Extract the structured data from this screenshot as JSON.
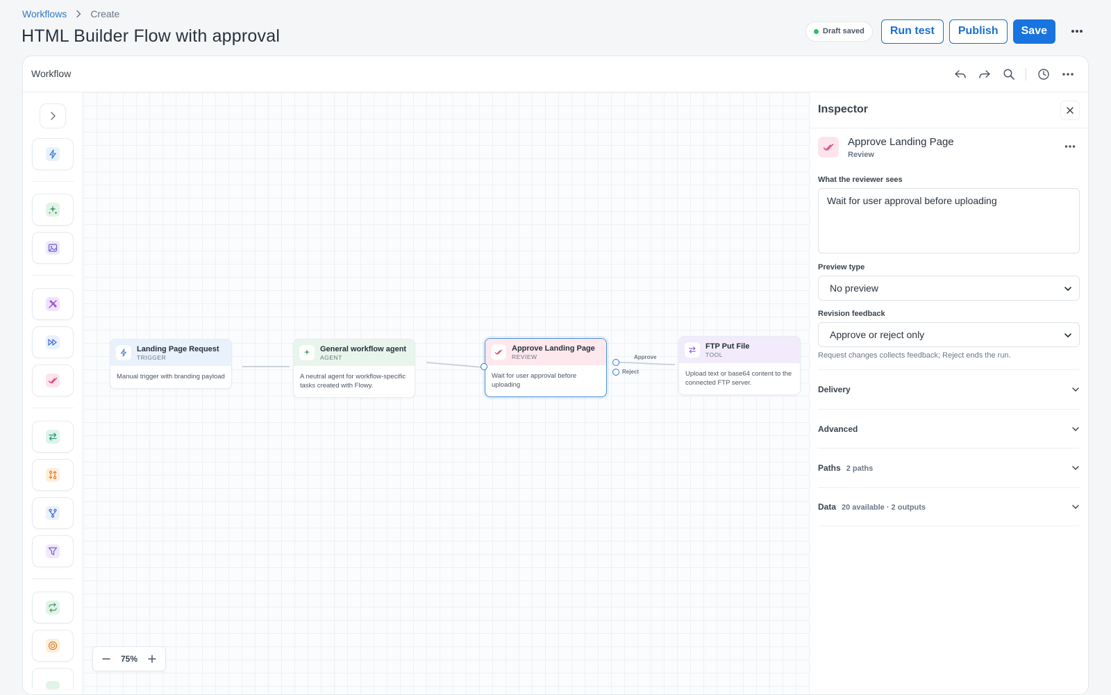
{
  "breadcrumb": {
    "parent": "Workflows",
    "current": "Create"
  },
  "page": {
    "title": "HTML Builder Flow with approval"
  },
  "header": {
    "draft_status": "Draft saved",
    "run_test_label": "Run test",
    "publish_label": "Publish",
    "save_label": "Save"
  },
  "workflow": {
    "title": "Workflow",
    "tools": [
      "undo-icon",
      "redo-icon",
      "search-icon",
      "history-icon",
      "more-icon"
    ]
  },
  "rail": {
    "items": [
      "trigger",
      "agent",
      "image",
      "magic",
      "skip",
      "review",
      "swap",
      "compare",
      "branch",
      "filter",
      "loop",
      "target"
    ]
  },
  "nodes": [
    {
      "id": "trigger",
      "title": "Landing Page Request",
      "type": "TRIGGER",
      "description": "Manual trigger with branding payload",
      "header_color": "#e8f1fc",
      "icon_color": "#4a82d6"
    },
    {
      "id": "agent",
      "title": "General workflow agent",
      "type": "AGENT",
      "description": "A neutral agent for workflow-specific tasks created with Flowy.",
      "header_color": "#e7f5ec",
      "icon_color": "#3a9b61"
    },
    {
      "id": "review",
      "title": "Approve Landing Page",
      "type": "REVIEW",
      "description": "Wait for user approval before uploading",
      "header_color": "#fde8ee",
      "icon_color": "#d94a7a"
    },
    {
      "id": "tool",
      "title": "FTP Put File",
      "type": "TOOL",
      "description": "Upload text or base64 content to the connected FTP server.",
      "header_color": "#f1ebfb",
      "icon_color": "#8a5fd1"
    }
  ],
  "edges": {
    "approve_label": "Approve",
    "reject_label": "Reject"
  },
  "zoom": {
    "level": "75%"
  },
  "inspector": {
    "title": "Inspector",
    "node_name": "Approve Landing Page",
    "node_kind": "Review",
    "reviewer_label": "What the reviewer sees",
    "reviewer_text": "Wait for user approval before uploading",
    "preview_label": "Preview type",
    "preview_value": "No preview",
    "revision_label": "Revision feedback",
    "revision_value": "Approve or reject only",
    "revision_hint": "Request changes collects feedback; Reject ends the run.",
    "sections": [
      {
        "title": "Delivery",
        "meta": ""
      },
      {
        "title": "Advanced",
        "meta": ""
      },
      {
        "title": "Paths",
        "meta": "2 paths"
      },
      {
        "title": "Data",
        "meta": "20 available · 2 outputs"
      }
    ]
  },
  "colors": {
    "accent": "#1a74df",
    "selected_border": "#4a90d9",
    "status_green": "#22c55e"
  }
}
